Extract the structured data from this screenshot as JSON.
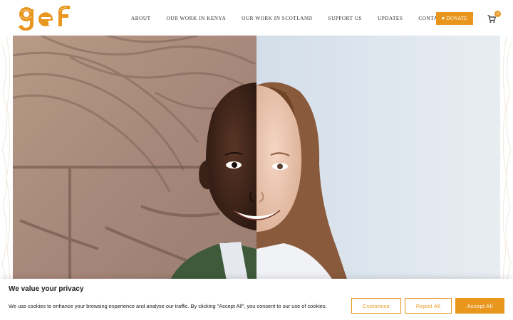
{
  "brand": {
    "logo_text": "gef",
    "accent_color": "#e8961e"
  },
  "nav": {
    "items": [
      {
        "label": "ABOUT"
      },
      {
        "label": "OUR WORK IN KENYA"
      },
      {
        "label": "OUR WORK IN SCOTLAND"
      },
      {
        "label": "SUPPORT US"
      },
      {
        "label": "UPDATES"
      },
      {
        "label": "CONTACT"
      }
    ],
    "donate_label": "DONATE",
    "donate_icon": "heart-icon",
    "cart_icon": "cart-icon",
    "cart_count": "0"
  },
  "hero": {
    "image_alt": "",
    "left_background": "textured clay wall",
    "right_background": "pale blue studio backdrop"
  },
  "cookie_banner": {
    "title": "We value your privacy",
    "text": "We use cookies to enhance your browsing experience and analyse our traffic. By clicking \"Accept All\", you consent to our use of cookies.",
    "customise_label": "Customise",
    "reject_label": "Reject All",
    "accept_label": "Accept All"
  }
}
